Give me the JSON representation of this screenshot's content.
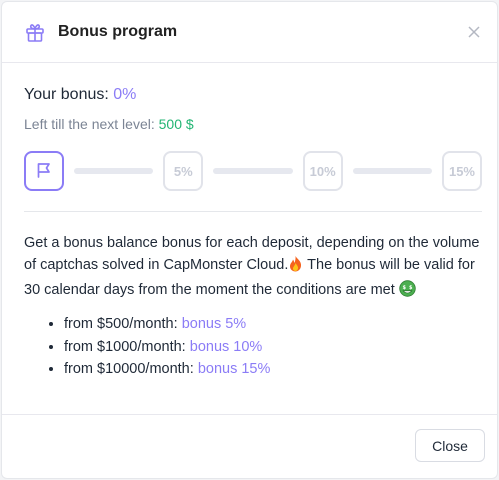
{
  "modal": {
    "title": "Bonus program",
    "icon": "gift-icon",
    "close_icon": "close-icon"
  },
  "bonus": {
    "label": "Your bonus:",
    "value": "0%",
    "next_level_label": "Left till the next level:",
    "next_level_value": "500 $"
  },
  "levels": [
    {
      "icon": "flag-icon",
      "label": "",
      "active": true
    },
    {
      "label": "5%",
      "active": false
    },
    {
      "label": "10%",
      "active": false
    },
    {
      "label": "15%",
      "active": false
    }
  ],
  "description": {
    "part1": "Get a bonus balance bonus for each deposit, depending on the volume of captchas solved in CapMonster Cloud.",
    "emoji1": "fire-emoji",
    "part2": " The bonus will be valid for 30 calendar days from the moment the conditions are met ",
    "emoji2": "money-face-emoji"
  },
  "tiers": [
    {
      "text": "from $500/month:",
      "bonus": "bonus 5%"
    },
    {
      "text": "from $1000/month:",
      "bonus": "bonus 10%"
    },
    {
      "text": "from $10000/month:",
      "bonus": "bonus 15%"
    }
  ],
  "footer": {
    "close_label": "Close"
  },
  "colors": {
    "accent": "#8b7cf6",
    "green": "#22b573",
    "muted": "#7b8494"
  }
}
